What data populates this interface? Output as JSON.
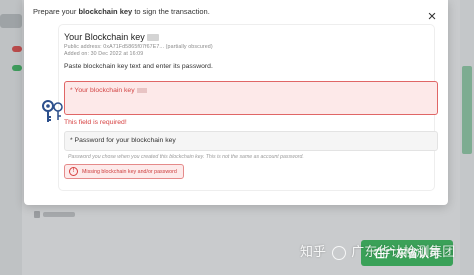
{
  "modal": {
    "header_prefix": "Prepare your ",
    "header_bold": "blockchain key",
    "header_suffix": " to sign the transaction.",
    "close_glyph": "×"
  },
  "key": {
    "title": "Your Blockchain key",
    "public_address_line": "Public address: 0xA71Fd5865f07f67E7... (partially obscured)",
    "added_on_line": "Added on: 30 Dec 2022 at 16:09"
  },
  "instructions": "Paste blockchain key text and enter its password.",
  "fields": {
    "blockchain_key": {
      "label": "* Your blockchain key",
      "error": "This field is required!"
    },
    "password": {
      "label": "* Password for your blockchain key",
      "hint": "Password you chose when you created this blockchain key. This is not the same as account password."
    }
  },
  "alert": {
    "icon": "!",
    "text": "Missing blockchain key and/or password"
  },
  "background": {
    "footer_button_label": "在广东省认可"
  },
  "watermark": {
    "text_left": "知乎",
    "text_right": "广东华认检测集团"
  },
  "colors": {
    "error": "#d64040",
    "error_bg": "#fde9e9",
    "accent_green": "#3aa158",
    "key_icon": "#2c4f8c"
  }
}
